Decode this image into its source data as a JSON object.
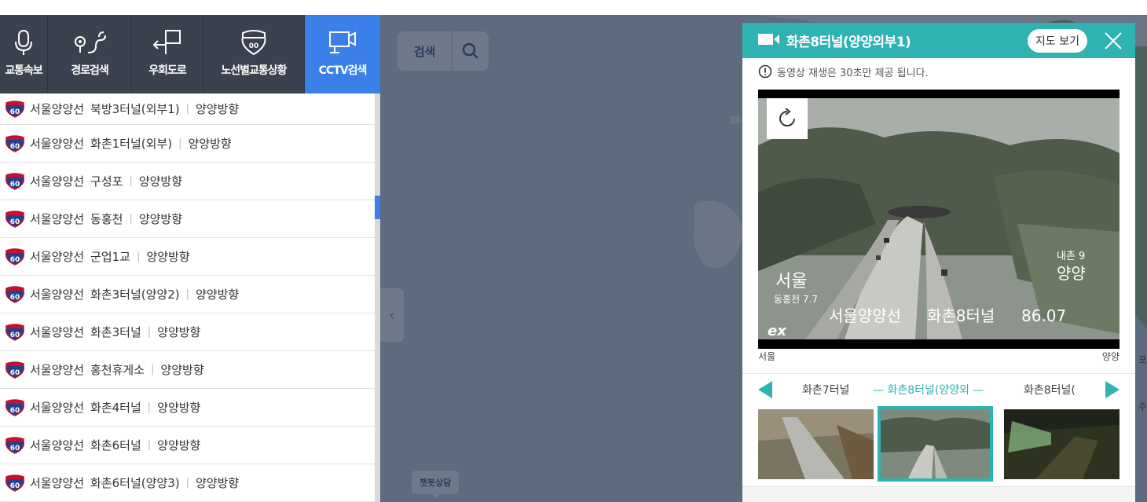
{
  "nav": {
    "items": [
      {
        "label": "교통속보",
        "icon": "microphone-icon"
      },
      {
        "label": "경로검색",
        "icon": "route-icon"
      },
      {
        "label": "우회도로",
        "icon": "detour-icon"
      },
      {
        "label": "노선별교통상황",
        "icon": "highway-shield-icon"
      },
      {
        "label": "CCTV검색",
        "icon": "cctv-icon",
        "active": true
      }
    ]
  },
  "list": {
    "items": [
      {
        "route": "서울양양선",
        "name": "북방3터널(외부1)",
        "direction": "양양방향"
      },
      {
        "route": "서울양양선",
        "name": "화촌1터널(외부)",
        "direction": "양양방향"
      },
      {
        "route": "서울양양선",
        "name": "구성포",
        "direction": "양양방향"
      },
      {
        "route": "서울양양선",
        "name": "동홍천",
        "direction": "양양방향"
      },
      {
        "route": "서울양양선",
        "name": "군업1교",
        "direction": "양양방향"
      },
      {
        "route": "서울양양선",
        "name": "화촌3터널(양양2)",
        "direction": "양양방향"
      },
      {
        "route": "서울양양선",
        "name": "화촌3터널",
        "direction": "양양방향"
      },
      {
        "route": "서울양양선",
        "name": "홍천휴게소",
        "direction": "양양방향"
      },
      {
        "route": "서울양양선",
        "name": "화촌4터널",
        "direction": "양양방향"
      },
      {
        "route": "서울양양선",
        "name": "화촌6터널",
        "direction": "양양방향"
      },
      {
        "route": "서울양양선",
        "name": "화촌6터널(양양3)",
        "direction": "양양방향"
      }
    ],
    "shield_number": "60"
  },
  "map": {
    "search_label": "검색",
    "chatbot_label": "챗봇상담",
    "edge_text_1": "포",
    "edge_text_2": "주"
  },
  "popup": {
    "title": "화촌8터널(양양외부1)",
    "map_button": "지도 보기",
    "notice": "동영상 재생은 30초만 제공 됩니다.",
    "video_left_label": "서울",
    "video_right_label": "양양",
    "overlay": {
      "left_dest": "서울",
      "left_sub": "동홍천 7.7",
      "right_sub": "내촌 9",
      "right_dest": "양양",
      "caption_route": "서울양양선",
      "caption_name": "화촌8터널",
      "caption_km": "86.07",
      "logo": "ex"
    },
    "nav": {
      "prev": "화촌7터널",
      "current": "화촌8터널(양양외",
      "next": "화촌8터널("
    }
  },
  "colors": {
    "nav_bg": "#3c4150",
    "nav_active": "#3b7fe9",
    "map_bg": "#5d6b7f",
    "accent": "#2fb2b2"
  }
}
